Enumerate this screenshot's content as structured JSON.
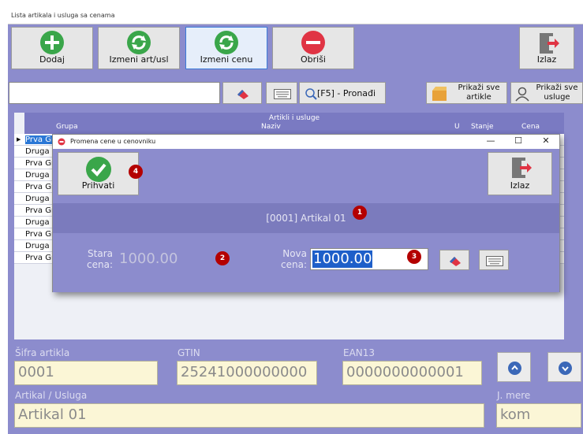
{
  "window": {
    "title": "Lista artikala i usluga sa cenama"
  },
  "toolbar": {
    "add": "Dodaj",
    "edit": "Izmeni art/usl",
    "edit_price": "Izmeni cenu",
    "delete": "Obriši",
    "exit": "Izlaz"
  },
  "search": {
    "value": "",
    "find": "[F5] - Pronađi",
    "show_articles_1": "Prikaži sve",
    "show_articles_2": "artikle",
    "show_services_1": "Prikaži sve",
    "show_services_2": "usluge"
  },
  "list": {
    "title": "Artikli i usluge",
    "columns": [
      "Grupa",
      "Naziv",
      "U",
      "Stanje",
      "Cena"
    ],
    "rows": [
      "Prva Gr",
      "Druga",
      "Prva Gr",
      "Druga",
      "Prva Gr",
      "Druga",
      "Prva Gr",
      "Druga",
      "Prva Gr",
      "Druga",
      "Prva Gr"
    ]
  },
  "fields": {
    "code_label": "Šifra artikla",
    "code": "0001",
    "gtin_label": "GTIN",
    "gtin": "25241000000000",
    "ean_label": "EAN13",
    "ean": "0000000000001",
    "name_label": "Artikal / Usluga",
    "name": "Artikal 01",
    "unit_label": "J. mere",
    "unit": "kom"
  },
  "dialog": {
    "title": "Promena cene u cenovniku",
    "accept": "Prihvati",
    "exit": "Izlaz",
    "header": "[0001] Artikal 01",
    "old_price_label_1": "Stara",
    "old_price_label_2": "cena:",
    "old_price": "1000.00",
    "new_price_label_1": "Nova",
    "new_price_label_2": "cena:",
    "new_price": "1000.00",
    "badges": [
      "1",
      "2",
      "3",
      "4"
    ],
    "minimize": "—",
    "maximize": "☐",
    "close": "✕"
  },
  "colors": {
    "background": "#8c8ccd",
    "accept": "#3aa64a",
    "delete": "#e03444",
    "badge": "#b40000",
    "selection": "#2b78d6"
  }
}
